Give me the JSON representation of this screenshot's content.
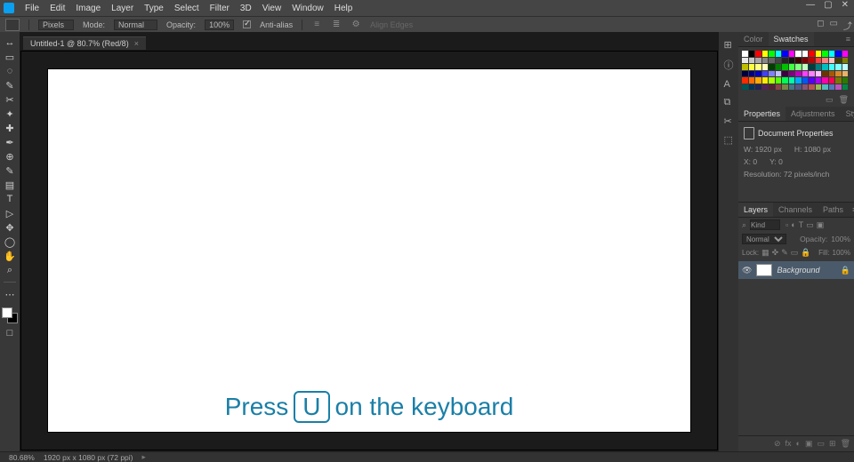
{
  "menu": {
    "items": [
      "File",
      "Edit",
      "Image",
      "Layer",
      "Type",
      "Select",
      "Filter",
      "3D",
      "View",
      "Window",
      "Help"
    ]
  },
  "win_controls": [
    "—",
    "▢",
    "✕"
  ],
  "options": {
    "units": "Pixels",
    "mode_label": "Mode:",
    "mode": "Normal",
    "opacity_label": "Opacity:",
    "opacity": "100%",
    "antialias": "Anti-alias",
    "align": "Align Edges"
  },
  "share_icons": [
    "◻",
    "▭",
    "⤴"
  ],
  "tab": {
    "title": "Untitled-1 @ 80.7% (Red/8)"
  },
  "tools": [
    "↔",
    "▭",
    "◌",
    "✎",
    "✂",
    "✦",
    "✚",
    "✒",
    "⊕",
    "✎",
    "▤",
    "T",
    "▷",
    "✥",
    "◯",
    "✋",
    "⌕"
  ],
  "small_tools": [
    "⋯",
    "□"
  ],
  "icon_col": [
    "⊞",
    "ⓘ",
    "A",
    "⧉",
    "✂",
    "⬚"
  ],
  "panel1": {
    "tabs": [
      "Color",
      "Swatches"
    ],
    "active": 1
  },
  "swatch_colors": [
    "#ffffff",
    "#000000",
    "#ff0000",
    "#ffff00",
    "#00ff00",
    "#00ffff",
    "#0000ff",
    "#ff00ff",
    "#ffffff",
    "#ffffff",
    "#ff0000",
    "#ffff00",
    "#00ff00",
    "#00ffff",
    "#0000ff",
    "#ff00ff",
    "#e9e9e9",
    "#c8c8c8",
    "#a7a7a7",
    "#868686",
    "#656565",
    "#444444",
    "#232323",
    "#111111",
    "#3f0000",
    "#7f0000",
    "#bf0000",
    "#ff4040",
    "#ff8080",
    "#ffc0c0",
    "#3f3f00",
    "#7f7f00",
    "#bfbf00",
    "#ffff40",
    "#ffff80",
    "#ffffc0",
    "#003f00",
    "#007f00",
    "#00bf00",
    "#40ff40",
    "#80ff80",
    "#c0ffc0",
    "#003f3f",
    "#007f7f",
    "#00bfbf",
    "#40ffff",
    "#80ffff",
    "#c0ffff",
    "#00003f",
    "#00007f",
    "#0000bf",
    "#4040ff",
    "#8080ff",
    "#c0c0ff",
    "#3f003f",
    "#7f007f",
    "#bf00bf",
    "#ff40ff",
    "#ff80ff",
    "#ffc0ff",
    "#6a3500",
    "#a65800",
    "#d98a2b",
    "#e8b26a",
    "#ff2a00",
    "#ff6a00",
    "#ffaa00",
    "#ffeb00",
    "#aaff00",
    "#55ff00",
    "#00ff55",
    "#00ffaa",
    "#00aaff",
    "#0055ff",
    "#5500ff",
    "#aa00ff",
    "#ff00aa",
    "#ff0055",
    "#7a7a00",
    "#2a7a00",
    "#005555",
    "#003355",
    "#222255",
    "#552255",
    "#552233",
    "#884444",
    "#778844",
    "#447788",
    "#555588",
    "#885577",
    "#bb5555",
    "#99bb55",
    "#55bbbb",
    "#5577bb",
    "#bb55bb",
    "#008844"
  ],
  "panel2": {
    "tabs": [
      "Properties",
      "Adjustments",
      "Styles"
    ],
    "active": 0,
    "doc_label": "Document Properties",
    "w_label": "W:",
    "w": "1920 px",
    "h_label": "H:",
    "h": "1080 px",
    "x_label": "X:",
    "x": "0",
    "y_label": "Y:",
    "y": "0",
    "resolution": "Resolution: 72 pixels/inch"
  },
  "panel3": {
    "tabs": [
      "Layers",
      "Channels",
      "Paths"
    ],
    "active": 0,
    "kind": "Kind",
    "blend": "Normal",
    "opacity_label": "Opacity:",
    "opacity": "100%",
    "lock_label": "Lock:",
    "fill_label": "Fill:",
    "fill": "100%",
    "layer_name": "Background"
  },
  "layer_foot": [
    "⊘",
    "fx",
    "◐",
    "▣",
    "▭",
    "⊞",
    "🗑"
  ],
  "status": {
    "zoom": "80.68%",
    "dims": "1920 px x 1080 px (72 ppi)"
  },
  "overlay": {
    "pre": "Press",
    "key": "U",
    "post": "on the keyboard"
  }
}
